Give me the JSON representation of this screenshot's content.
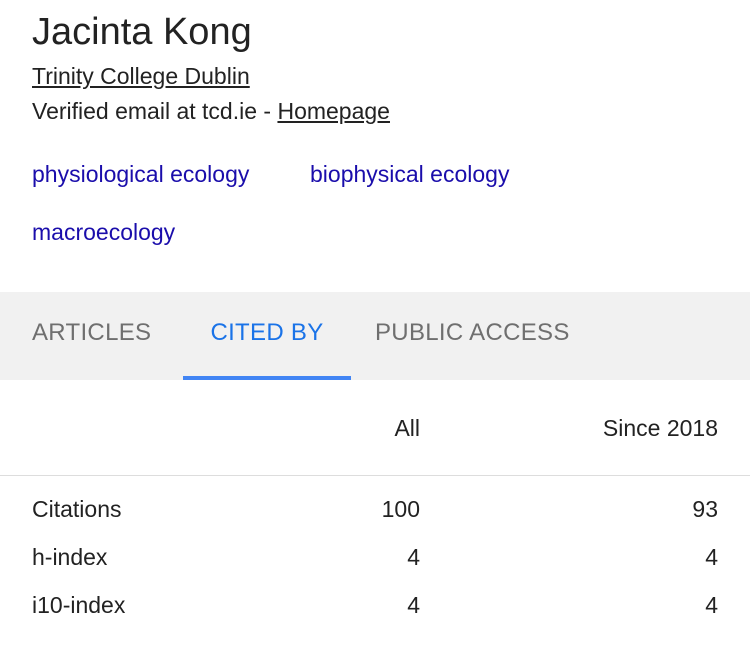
{
  "profile": {
    "name": "Jacinta Kong",
    "affiliation": "Trinity College Dublin",
    "email_text": "Verified email at tcd.ie - ",
    "homepage_label": "Homepage",
    "interests": [
      "physiological ecology",
      "biophysical ecology",
      "macroecology"
    ]
  },
  "tabs": [
    {
      "label": "ARTICLES",
      "active": false
    },
    {
      "label": "CITED BY",
      "active": true
    },
    {
      "label": "PUBLIC ACCESS",
      "active": false
    }
  ],
  "colors": {
    "accent": "#1a73e8",
    "link": "#1a0dab",
    "tabbar_bg": "#f1f1f1"
  },
  "citations_table": {
    "headers": [
      "",
      "All",
      "Since 2018"
    ],
    "rows": [
      {
        "label": "Citations",
        "all": "100",
        "since": "93"
      },
      {
        "label": "h-index",
        "all": "4",
        "since": "4"
      },
      {
        "label": "i10-index",
        "all": "4",
        "since": "4"
      }
    ]
  }
}
